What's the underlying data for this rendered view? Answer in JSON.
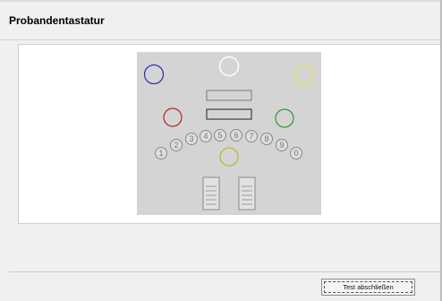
{
  "header": {
    "title": "Probandentastatur"
  },
  "keyboard": {
    "number_keys": [
      "1",
      "2",
      "3",
      "4",
      "5",
      "6",
      "7",
      "8",
      "9",
      "0"
    ],
    "colors": {
      "top_center": "#ffffff",
      "top_left": "#2b2bb0",
      "top_right": "#e6e64a",
      "left": "#b02424",
      "right": "#2a9a2a",
      "bottom_center": "#b7b72a",
      "background": "#d4d4d4"
    }
  },
  "footer": {
    "finish_button_label": "Test abschließen"
  }
}
